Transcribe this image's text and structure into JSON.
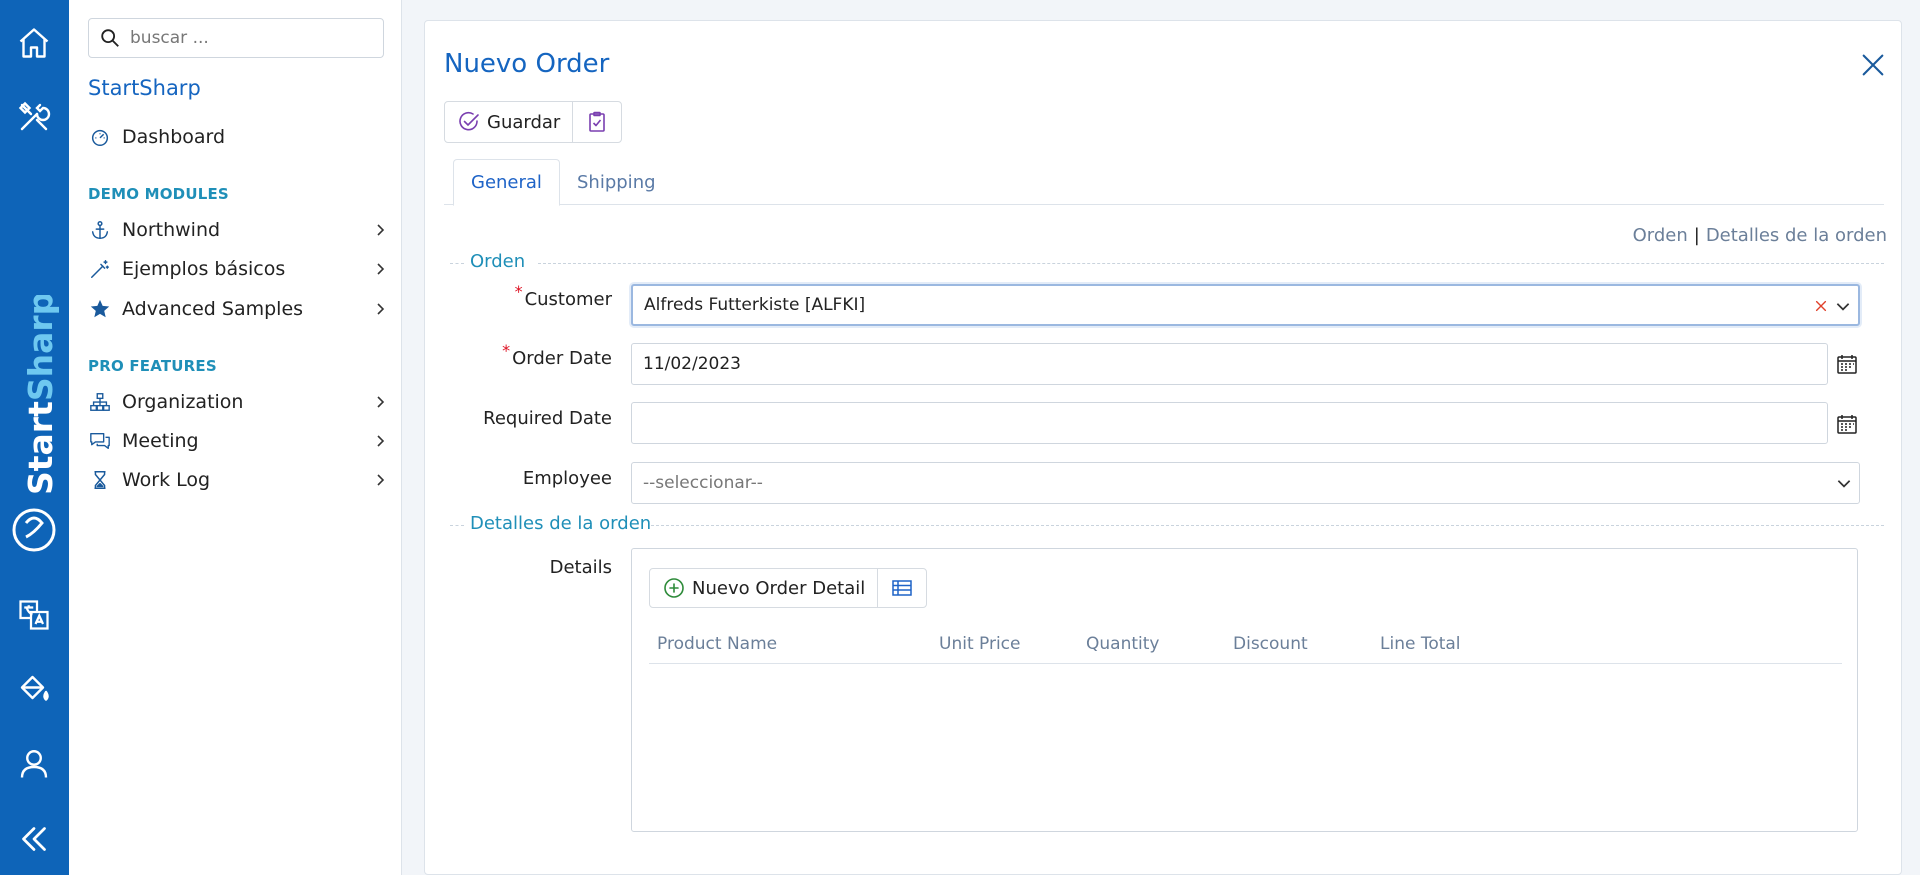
{
  "rail": {
    "icons": [
      "home-icon",
      "tools-icon",
      "translate-icon",
      "paint-bucket-icon",
      "user-icon",
      "collapse-icon"
    ],
    "brand": "StartSharp"
  },
  "sidebar": {
    "search_placeholder": "buscar ...",
    "brand_title": "StartSharp",
    "dashboard": "Dashboard",
    "demo_header": "DEMO MODULES",
    "demo_items": [
      "Northwind",
      "Ejemplos básicos",
      "Advanced Samples"
    ],
    "pro_header": "PRO FEATURES",
    "pro_items": [
      "Organization",
      "Meeting",
      "Work Log"
    ]
  },
  "dialog": {
    "title": "Nuevo Order",
    "save_label": "Guardar",
    "tabs": [
      "General",
      "Shipping"
    ],
    "crumbs": [
      "Orden",
      "Detalles de la orden"
    ],
    "crumb_sep": "|",
    "section_orden": "Orden",
    "customer_label": "Customer",
    "customer_value": "Alfreds Futterkiste [ALFKI]",
    "order_date_label": "Order Date",
    "order_date_value": "11/02/2023",
    "required_date_label": "Required Date",
    "required_date_value": "",
    "employee_label": "Employee",
    "employee_value": "--seleccionar--",
    "section_detalles": "Detalles de la orden",
    "details_label": "Details",
    "new_detail_label": "Nuevo Order Detail",
    "columns": [
      "Product Name",
      "Unit Price",
      "Quantity",
      "Discount",
      "Line Total"
    ],
    "required_mark": "*"
  },
  "colors": {
    "rail": "#0e64b8",
    "title": "#1565c0",
    "section": "#1f8fb8",
    "required": "#dd1122"
  }
}
